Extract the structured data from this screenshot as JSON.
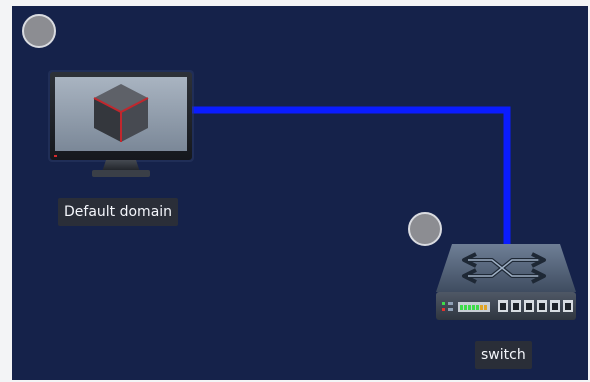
{
  "canvas": {
    "background": "#15224a",
    "link_color": "#0a1cff"
  },
  "nodes": {
    "domain": {
      "label": "Default domain",
      "icon": "monitor-with-cube-icon",
      "status_icon": "status-circle-icon"
    },
    "switch": {
      "label": "switch",
      "icon": "network-switch-icon",
      "status_icon": "status-circle-icon"
    }
  },
  "link": {
    "from": "Default domain",
    "to": "switch"
  }
}
